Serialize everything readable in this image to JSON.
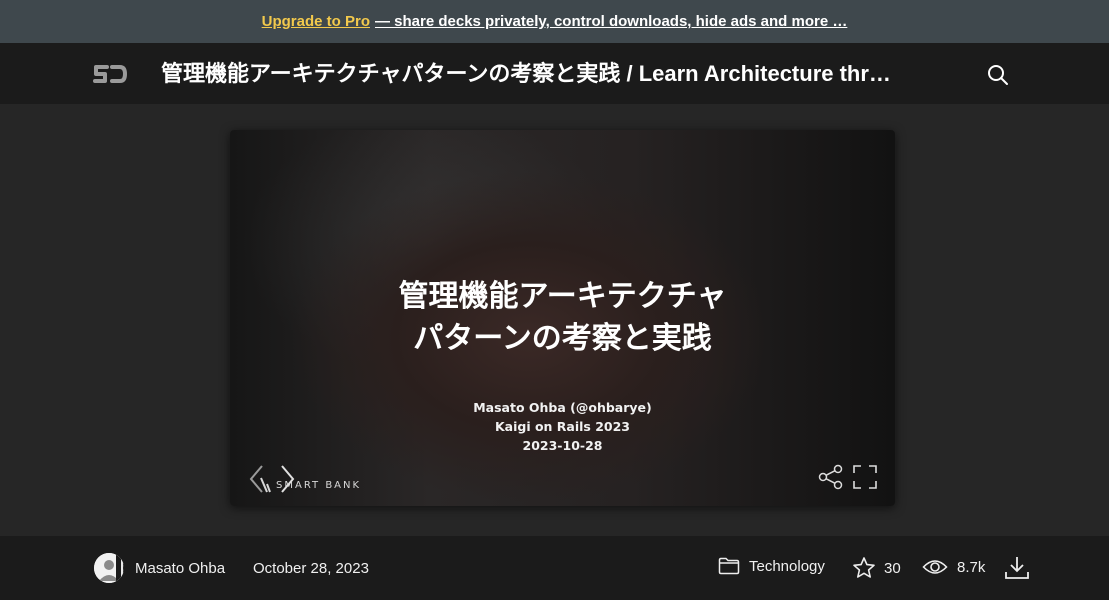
{
  "promo": {
    "pro_link": "Upgrade to Pro",
    "rest": "— share decks privately, control downloads, hide ads and more …"
  },
  "header": {
    "logo_icon": "speakerdeck-logo-icon",
    "title": "管理機能アーキテクチャパターンの考察と実践 / Learn Architecture thr…",
    "search_icon": "search-icon"
  },
  "slide": {
    "title_line1": "管理機能アーキテクチャ",
    "title_line2": "パターンの考察と実践",
    "presenter": "Masato Ohba (@ohbarye)",
    "event": "Kaigi on Rails 2023",
    "date": "2023-10-28",
    "brand": "SMART BANK"
  },
  "footer": {
    "author": "Masato Ohba",
    "date": "October 28, 2023",
    "category": "Technology",
    "stars": "30",
    "views": "8.7k"
  },
  "colors": {
    "promo_bg": "#3f484d",
    "pro_link": "#f2c94c",
    "header_bg": "#1b1b1b",
    "page_bg": "#262626"
  }
}
